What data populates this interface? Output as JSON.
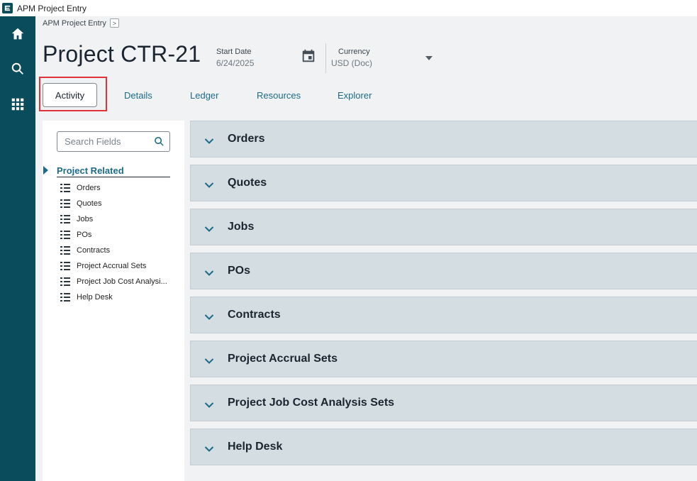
{
  "window": {
    "title": "APM Project Entry"
  },
  "breadcrumb": {
    "label": "APM Project Entry",
    "arrow": ">"
  },
  "header": {
    "title": "Project CTR-21",
    "start_date": {
      "label": "Start Date",
      "value": "6/24/2025"
    },
    "currency": {
      "label": "Currency",
      "value": "USD (Doc)"
    }
  },
  "tabs": [
    {
      "label": "Activity",
      "active": true
    },
    {
      "label": "Details"
    },
    {
      "label": "Ledger"
    },
    {
      "label": "Resources"
    },
    {
      "label": "Explorer"
    }
  ],
  "search": {
    "placeholder": "Search Fields"
  },
  "nav": {
    "group": "Project Related",
    "items": [
      "Orders",
      "Quotes",
      "Jobs",
      "POs",
      "Contracts",
      "Project Accrual Sets",
      "Project Job Cost Analysi...",
      "Help Desk"
    ]
  },
  "sections": [
    "Orders",
    "Quotes",
    "Jobs",
    "POs",
    "Contracts",
    "Project Accrual Sets",
    "Project Job Cost Analysis Sets",
    "Help Desk"
  ],
  "colors": {
    "rail": "#0a4b5c",
    "accent": "#1c6a8a",
    "highlight": "#e0323a",
    "section_bg": "#d3dde2"
  },
  "icons": {
    "rail": [
      "home-icon",
      "search-icon",
      "apps-grid-icon"
    ]
  }
}
